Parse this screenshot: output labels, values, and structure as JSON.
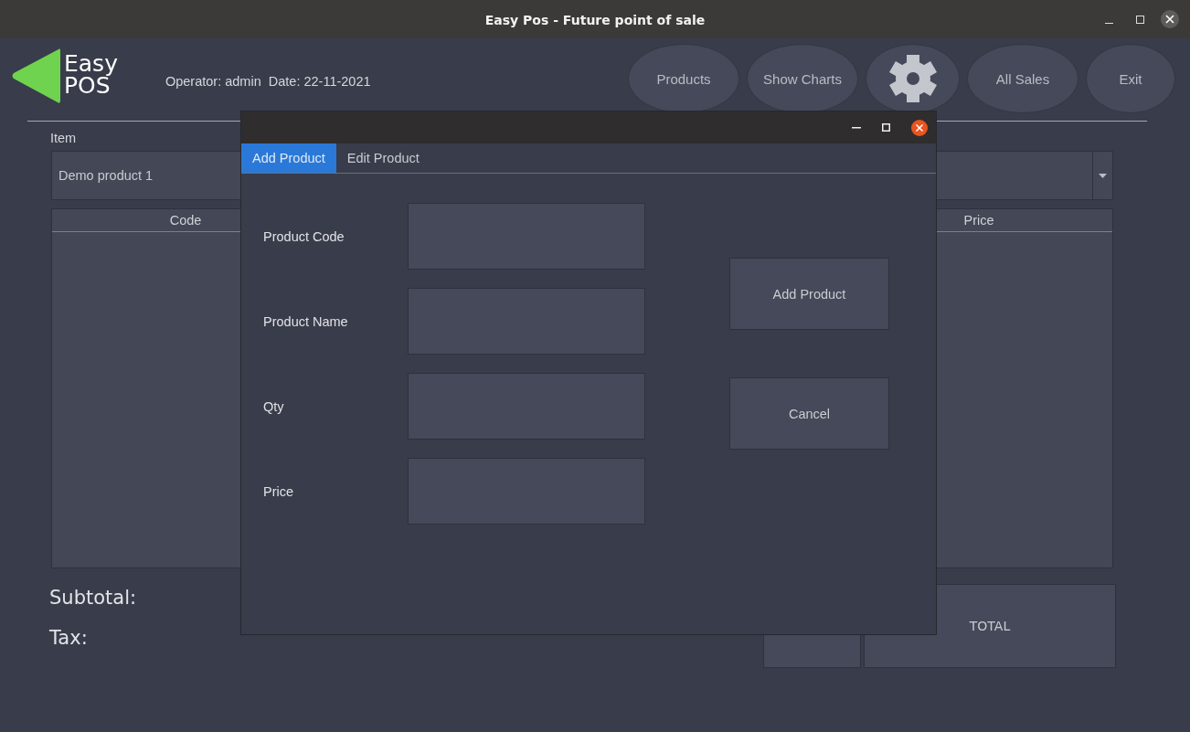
{
  "window": {
    "title": "Easy Pos - Future point of sale"
  },
  "logo": {
    "line_1": "Easy",
    "line_2": "POS"
  },
  "operator_info": "Operator: admin  Date: 22-11-2021",
  "toolbar": [
    {
      "kind": "text",
      "label": "Products"
    },
    {
      "kind": "text",
      "label": "Show Charts"
    },
    {
      "kind": "icon"
    },
    {
      "kind": "text",
      "label": "All Sales"
    },
    {
      "kind": "text",
      "label": "Exit"
    }
  ],
  "item_label": "Item",
  "item_select": {
    "value": "Demo product 1"
  },
  "table": {
    "columns": [
      "Code",
      "Price"
    ]
  },
  "summary": {
    "subtotal_label": "Subtotal:",
    "tax_label": "Tax:",
    "total_label": "TOTAL"
  },
  "dialog": {
    "tabs": [
      {
        "label": "Add Product",
        "selected": true
      },
      {
        "label": "Edit Product",
        "selected": false
      }
    ],
    "fields": [
      {
        "label": "Product Code"
      },
      {
        "label": "Product Name"
      },
      {
        "label": "Qty"
      },
      {
        "label": "Price"
      }
    ],
    "buttons": [
      "Add Product",
      "Cancel"
    ]
  }
}
